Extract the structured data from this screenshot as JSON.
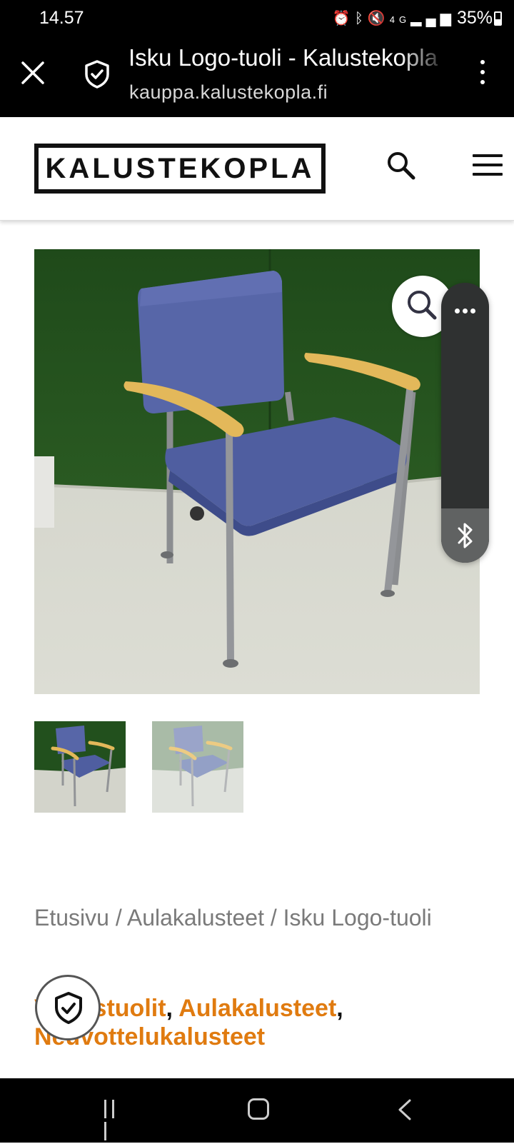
{
  "status_bar": {
    "time": "14.57",
    "icons": [
      "alarm-icon",
      "bluetooth-icon",
      "mute-icon",
      "4g-icon",
      "signal-icon"
    ],
    "network": "4G",
    "battery": "35%"
  },
  "browser": {
    "page_title": "Isku Logo-tuoli - Kalustekopla",
    "url": "kauppa.kalustekopla.fi"
  },
  "header": {
    "logo": "KALUSTEKOPLA"
  },
  "breadcrumb": {
    "home": "Etusivu",
    "sep1": " / ",
    "category": "Aulakalusteet",
    "sep2": " / ",
    "current": "Isku Logo-tuoli"
  },
  "categories": {
    "items": [
      "Vierastuolit",
      "Aulakalusteet",
      "Neuvottelukalusteet"
    ],
    "separator": ","
  },
  "colors": {
    "accent": "#e07b10",
    "breadcrumb": "#7a7a7a",
    "chair_fabric": "#5766a8",
    "wall": "#23501d"
  }
}
